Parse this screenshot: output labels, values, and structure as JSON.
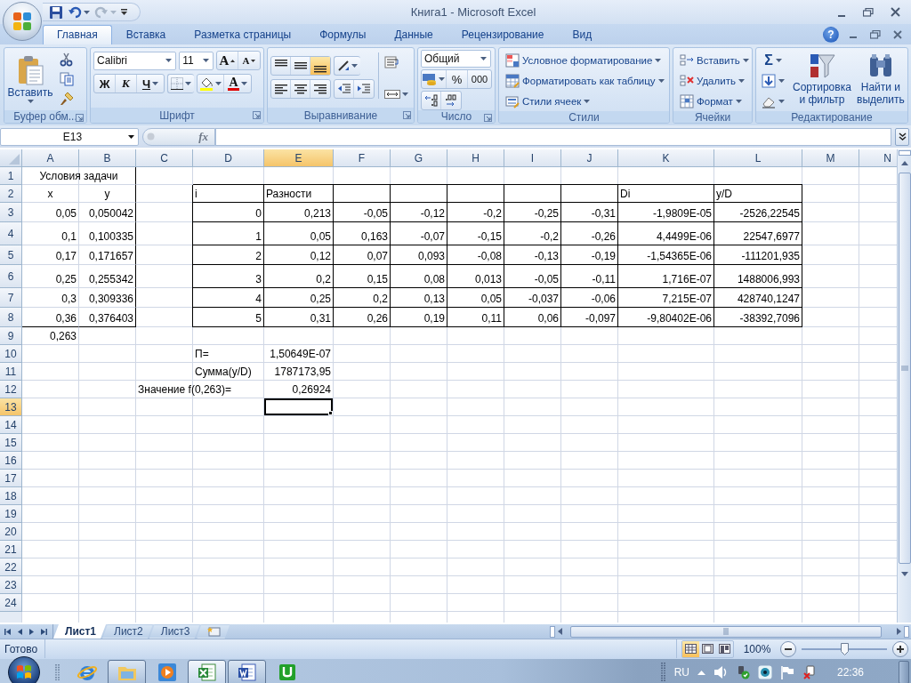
{
  "window": {
    "title": "Книга1 - Microsoft Excel",
    "help": "?"
  },
  "ribbon_tabs": [
    {
      "label": "Главная",
      "selected": true
    },
    {
      "label": "Вставка",
      "selected": false
    },
    {
      "label": "Разметка страницы",
      "selected": false
    },
    {
      "label": "Формулы",
      "selected": false
    },
    {
      "label": "Данные",
      "selected": false
    },
    {
      "label": "Рецензирование",
      "selected": false
    },
    {
      "label": "Вид",
      "selected": false
    }
  ],
  "ribbon_groups": [
    {
      "kind": "clipboard",
      "label": "Буфер обм...",
      "paste": "Вставить"
    },
    {
      "kind": "font",
      "label": "Шрифт",
      "font": "Calibri",
      "size": "11",
      "grow": "A",
      "shrink": "A",
      "bold": "Ж",
      "italic": "К",
      "underline": "Ч",
      "color_letter": "A"
    },
    {
      "kind": "alignment",
      "label": "Выравнивание",
      "vertical_align": [
        {
          "selected": false
        },
        {
          "selected": false
        },
        {
          "selected": true
        }
      ]
    },
    {
      "kind": "number",
      "label": "Число",
      "format": "Общий",
      "percent": "%",
      "thousands": "000"
    },
    {
      "kind": "styles",
      "label": "Стили",
      "buttons": [
        "Условное форматирование",
        "Форматировать как таблицу",
        "Стили ячеек"
      ]
    },
    {
      "kind": "cells",
      "label": "Ячейки",
      "buttons": [
        "Вставить",
        "Удалить",
        "Формат"
      ]
    },
    {
      "kind": "editing",
      "label": "Редактирование",
      "sum": "Σ",
      "sort": "Сортировка и фильтр",
      "find": "Найти и выделить"
    }
  ],
  "formula_bar": {
    "name_box": "E13",
    "fx": "fx"
  },
  "sheet": {
    "columns": [
      {
        "label": "A",
        "selected": false
      },
      {
        "label": "B",
        "selected": false
      },
      {
        "label": "C",
        "selected": false
      },
      {
        "label": "D",
        "selected": false
      },
      {
        "label": "E",
        "selected": true
      },
      {
        "label": "F",
        "selected": false
      },
      {
        "label": "G",
        "selected": false
      },
      {
        "label": "H",
        "selected": false
      },
      {
        "label": "I",
        "selected": false
      },
      {
        "label": "J",
        "selected": false
      },
      {
        "label": "K",
        "selected": false
      },
      {
        "label": "L",
        "selected": false
      },
      {
        "label": "M",
        "selected": false
      },
      {
        "label": "N",
        "selected": false
      }
    ],
    "rows": [
      {
        "label": "1",
        "selected": false,
        "cells": {
          "A": {
            "text": "Условия задачи",
            "kind": "merged",
            "outlined": true
          }
        }
      },
      {
        "label": "2",
        "selected": false,
        "cells": {
          "A": {
            "text": "x",
            "kind": "center",
            "outlined": true
          },
          "B": {
            "text": "y",
            "kind": "center",
            "outlined": true
          },
          "D": {
            "text": "i",
            "kind": "text",
            "bordered": true
          },
          "E": {
            "text": "Разности",
            "kind": "text",
            "bordered": true
          },
          "F": {
            "bordered": true
          },
          "G": {
            "bordered": true
          },
          "H": {
            "bordered": true
          },
          "I": {
            "bordered": true
          },
          "J": {
            "bordered": true
          },
          "K": {
            "text": "Di",
            "kind": "text",
            "bordered": true
          },
          "L": {
            "text": "y/D",
            "kind": "text",
            "bordered": true
          }
        }
      },
      {
        "label": "3",
        "selected": false,
        "cells": {
          "A": {
            "text": "0,05",
            "kind": "number",
            "outlined": true
          },
          "B": {
            "text": "0,050042",
            "kind": "number",
            "outlined": true
          },
          "D": {
            "text": "0",
            "kind": "number",
            "bordered": true
          },
          "E": {
            "text": "0,213",
            "kind": "number",
            "bordered": true
          },
          "F": {
            "text": "-0,05",
            "kind": "number",
            "bordered": true
          },
          "G": {
            "text": "-0,12",
            "kind": "number",
            "bordered": true
          },
          "H": {
            "text": "-0,2",
            "kind": "number",
            "bordered": true
          },
          "I": {
            "text": "-0,25",
            "kind": "number",
            "bordered": true
          },
          "J": {
            "text": "-0,31",
            "kind": "number",
            "bordered": true
          },
          "K": {
            "text": "-1,9809E-05",
            "kind": "number",
            "bordered": true
          },
          "L": {
            "text": "-2526,22545",
            "kind": "number",
            "bordered": true
          }
        }
      },
      {
        "label": "4",
        "selected": false,
        "cells": {
          "A": {
            "text": "0,1",
            "kind": "number",
            "outlined": true
          },
          "B": {
            "text": "0,100335",
            "kind": "number",
            "outlined": true
          },
          "D": {
            "text": "1",
            "kind": "number",
            "bordered": true
          },
          "E": {
            "text": "0,05",
            "kind": "number",
            "bordered": true
          },
          "F": {
            "text": "0,163",
            "kind": "number",
            "bordered": true
          },
          "G": {
            "text": "-0,07",
            "kind": "number",
            "bordered": true
          },
          "H": {
            "text": "-0,15",
            "kind": "number",
            "bordered": true
          },
          "I": {
            "text": "-0,2",
            "kind": "number",
            "bordered": true
          },
          "J": {
            "text": "-0,26",
            "kind": "number",
            "bordered": true
          },
          "K": {
            "text": "4,4499E-06",
            "kind": "number",
            "bordered": true
          },
          "L": {
            "text": "22547,6977",
            "kind": "number",
            "bordered": true
          }
        }
      },
      {
        "label": "5",
        "selected": false,
        "cells": {
          "A": {
            "text": "0,17",
            "kind": "number",
            "outlined": true
          },
          "B": {
            "text": "0,171657",
            "kind": "number",
            "outlined": true
          },
          "D": {
            "text": "2",
            "kind": "number",
            "bordered": true
          },
          "E": {
            "text": "0,12",
            "kind": "number",
            "bordered": true
          },
          "F": {
            "text": "0,07",
            "kind": "number",
            "bordered": true
          },
          "G": {
            "text": "0,093",
            "kind": "number",
            "bordered": true
          },
          "H": {
            "text": "-0,08",
            "kind": "number",
            "bordered": true
          },
          "I": {
            "text": "-0,13",
            "kind": "number",
            "bordered": true
          },
          "J": {
            "text": "-0,19",
            "kind": "number",
            "bordered": true
          },
          "K": {
            "text": "-1,54365E-06",
            "kind": "number",
            "bordered": true
          },
          "L": {
            "text": "-111201,935",
            "kind": "number",
            "bordered": true
          }
        }
      },
      {
        "label": "6",
        "selected": false,
        "cells": {
          "A": {
            "text": "0,25",
            "kind": "number",
            "outlined": true
          },
          "B": {
            "text": "0,255342",
            "kind": "number",
            "outlined": true
          },
          "D": {
            "text": "3",
            "kind": "number",
            "bordered": true
          },
          "E": {
            "text": "0,2",
            "kind": "number",
            "bordered": true
          },
          "F": {
            "text": "0,15",
            "kind": "number",
            "bordered": true
          },
          "G": {
            "text": "0,08",
            "kind": "number",
            "bordered": true
          },
          "H": {
            "text": "0,013",
            "kind": "number",
            "bordered": true
          },
          "I": {
            "text": "-0,05",
            "kind": "number",
            "bordered": true
          },
          "J": {
            "text": "-0,11",
            "kind": "number",
            "bordered": true
          },
          "K": {
            "text": "1,716E-07",
            "kind": "number",
            "bordered": true
          },
          "L": {
            "text": "1488006,993",
            "kind": "number",
            "bordered": true
          }
        }
      },
      {
        "label": "7",
        "selected": false,
        "cells": {
          "A": {
            "text": "0,3",
            "kind": "number",
            "outlined": true
          },
          "B": {
            "text": "0,309336",
            "kind": "number",
            "outlined": true
          },
          "D": {
            "text": "4",
            "kind": "number",
            "bordered": true
          },
          "E": {
            "text": "0,25",
            "kind": "number",
            "bordered": true
          },
          "F": {
            "text": "0,2",
            "kind": "number",
            "bordered": true
          },
          "G": {
            "text": "0,13",
            "kind": "number",
            "bordered": true
          },
          "H": {
            "text": "0,05",
            "kind": "number",
            "bordered": true
          },
          "I": {
            "text": "-0,037",
            "kind": "number",
            "bordered": true
          },
          "J": {
            "text": "-0,06",
            "kind": "number",
            "bordered": true
          },
          "K": {
            "text": "7,215E-07",
            "kind": "number",
            "bordered": true
          },
          "L": {
            "text": "428740,1247",
            "kind": "number",
            "bordered": true
          }
        }
      },
      {
        "label": "8",
        "selected": false,
        "cells": {
          "A": {
            "text": "0,36",
            "kind": "number",
            "outlined": true
          },
          "B": {
            "text": "0,376403",
            "kind": "number",
            "outlined": true
          },
          "D": {
            "text": "5",
            "kind": "number",
            "bordered": true
          },
          "E": {
            "text": "0,31",
            "kind": "number",
            "bordered": true
          },
          "F": {
            "text": "0,26",
            "kind": "number",
            "bordered": true
          },
          "G": {
            "text": "0,19",
            "kind": "number",
            "bordered": true
          },
          "H": {
            "text": "0,11",
            "kind": "number",
            "bordered": true
          },
          "I": {
            "text": "0,06",
            "kind": "number",
            "bordered": true
          },
          "J": {
            "text": "-0,097",
            "kind": "number",
            "bordered": true
          },
          "K": {
            "text": "-9,80402E-06",
            "kind": "number",
            "bordered": true
          },
          "L": {
            "text": "-38392,7096",
            "kind": "number",
            "bordered": true
          }
        }
      },
      {
        "label": "9",
        "selected": false,
        "cells": {
          "A": {
            "text": "0,263",
            "kind": "number"
          }
        }
      },
      {
        "label": "10",
        "selected": false,
        "cells": {
          "D": {
            "text": "П=",
            "kind": "text"
          },
          "E": {
            "text": "1,50649E-07",
            "kind": "number"
          }
        }
      },
      {
        "label": "11",
        "selected": false,
        "cells": {
          "D": {
            "text": "Сумма(y/D)",
            "kind": "text"
          },
          "E": {
            "text": "1787173,95",
            "kind": "number"
          }
        }
      },
      {
        "label": "12",
        "selected": false,
        "cells": {
          "C": {
            "text": "Значение f(0,263)=",
            "kind": "spill"
          },
          "E": {
            "text": "0,26924",
            "kind": "number"
          }
        }
      },
      {
        "label": "13",
        "selected": true
      },
      {
        "label": "14",
        "selected": false
      },
      {
        "label": "15",
        "selected": false
      },
      {
        "label": "16",
        "selected": false
      },
      {
        "label": "17",
        "selected": false
      },
      {
        "label": "18",
        "selected": false
      },
      {
        "label": "19",
        "selected": false
      },
      {
        "label": "20",
        "selected": false
      },
      {
        "label": "21",
        "selected": false
      },
      {
        "label": "22",
        "selected": false
      },
      {
        "label": "23",
        "selected": false
      },
      {
        "label": "24",
        "selected": false
      }
    ]
  },
  "sheet_tabs": [
    {
      "label": "Лист1",
      "selected": true
    },
    {
      "label": "Лист2",
      "selected": false
    },
    {
      "label": "Лист3",
      "selected": false
    }
  ],
  "status_bar": {
    "status": "Готово",
    "views": [
      {
        "selected": true
      },
      {
        "selected": false
      },
      {
        "selected": false
      }
    ],
    "zoom": "100%",
    "zoom_slider": {
      "level": 0.5
    }
  },
  "taskbar": {
    "apps": [
      {
        "kind": "browser",
        "running": false,
        "selected": false
      },
      {
        "kind": "folder",
        "running": true,
        "selected": false
      },
      {
        "kind": "media",
        "running": false,
        "selected": false
      },
      {
        "kind": "spreadsheet",
        "running": true,
        "selected": true
      },
      {
        "kind": "document",
        "running": true,
        "selected": false
      },
      {
        "kind": "torrent",
        "running": false,
        "selected": false
      }
    ],
    "language": "RU",
    "clock": "22:36"
  }
}
